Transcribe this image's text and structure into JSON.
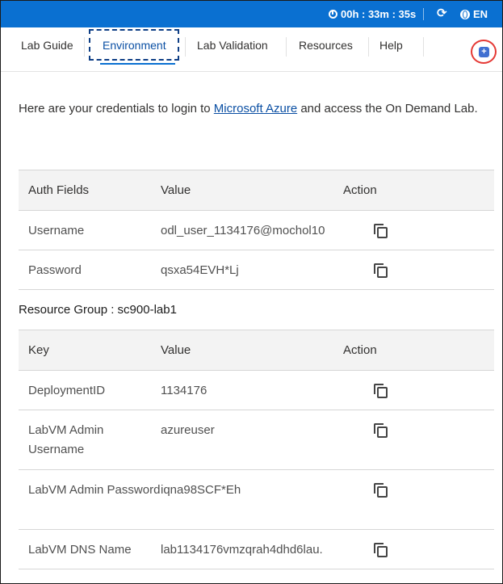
{
  "topbar": {
    "timer": "00h : 33m : 35s",
    "language": "EN",
    "icons": {
      "timer": "clock-icon",
      "refresh": "refresh-icon",
      "language": "globe-icon"
    }
  },
  "tabs": [
    {
      "label": "Lab Guide",
      "active": false
    },
    {
      "label": "Environment",
      "active": true
    },
    {
      "label": "Lab Validation",
      "active": false
    },
    {
      "label": "Resources",
      "active": false
    },
    {
      "label": "Help",
      "active": false
    }
  ],
  "intro": {
    "text_before": "Here are your credentials to login to ",
    "link": "Microsoft Azure",
    "text_after": " and access the On Demand Lab."
  },
  "auth_table": {
    "headers": [
      "Auth Fields",
      "Value",
      "Action"
    ],
    "rows": [
      {
        "field": "Username",
        "value": "odl_user_1134176@mochol10"
      },
      {
        "field": "Password",
        "value": "qsxa54EVH*Lj"
      }
    ]
  },
  "resource_group": {
    "title": "Resource Group : sc900-lab1",
    "headers": [
      "Key",
      "Value",
      "Action"
    ],
    "rows": [
      {
        "key": "DeploymentID",
        "value": "1134176"
      },
      {
        "key": "LabVM Admin Username",
        "value": "azureuser"
      },
      {
        "key": "LabVM Admin Password",
        "value": "iqna98SCF*Eh"
      },
      {
        "key": "LabVM DNS Name",
        "value": "lab1134176vmzqrah4dhd6lau."
      }
    ]
  },
  "colors": {
    "topbar": "#0a70d1",
    "accent": "#0a4fa3",
    "highlight_circle": "#e53935",
    "focus_outline": "#0e3e85"
  }
}
